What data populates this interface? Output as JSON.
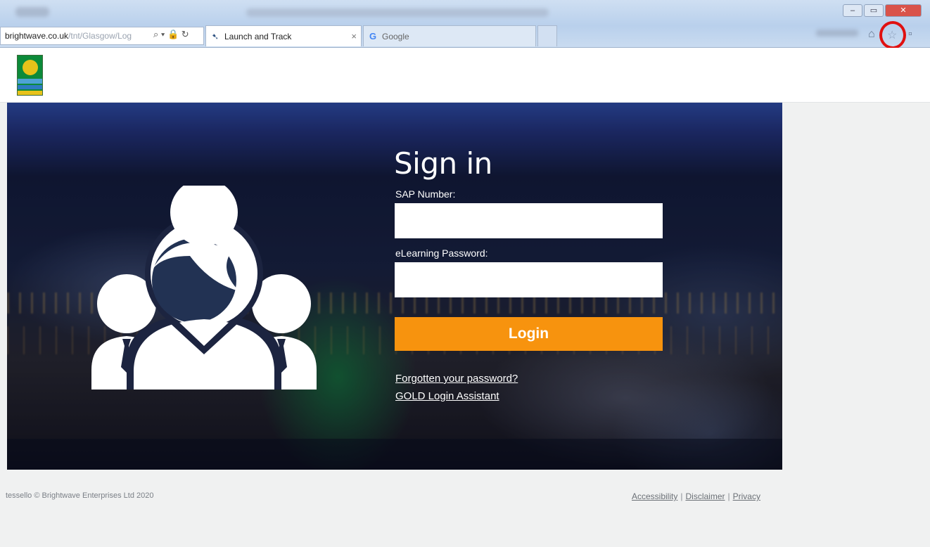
{
  "browser": {
    "address_url": "brightwave.co.uk",
    "address_url_faint": "/tnt/Glasgow/Log",
    "address_icons": "⌕ ▾ 🔒 ↻",
    "tabs": [
      {
        "label": "Launch and Track",
        "close": "×"
      },
      {
        "label": "Google",
        "favicon": "G"
      }
    ],
    "window_controls": {
      "minimize": "–",
      "maximize": "▭",
      "close": "✕"
    },
    "toolbar_icons": [
      "home-icon",
      "star-icon",
      "gear-icon"
    ],
    "highlight_color": "#e01010"
  },
  "header": {
    "logo": "glasgow-council-logo"
  },
  "signin": {
    "title": "Sign in",
    "sap_label": "SAP Number:",
    "sap_value": "",
    "password_label": "eLearning Password:",
    "password_value": "",
    "login_button": "Login",
    "forgot_link": "Forgotten your password?",
    "gold_link": "GOLD Login Assistant"
  },
  "colors": {
    "login_button": "#f7930e",
    "hero_top": "#2f4fa8"
  },
  "footer": {
    "copyright": "tessello © Brightwave Enterprises Ltd 2020",
    "links": [
      "Accessibility",
      "Disclaimer",
      "Privacy"
    ]
  }
}
